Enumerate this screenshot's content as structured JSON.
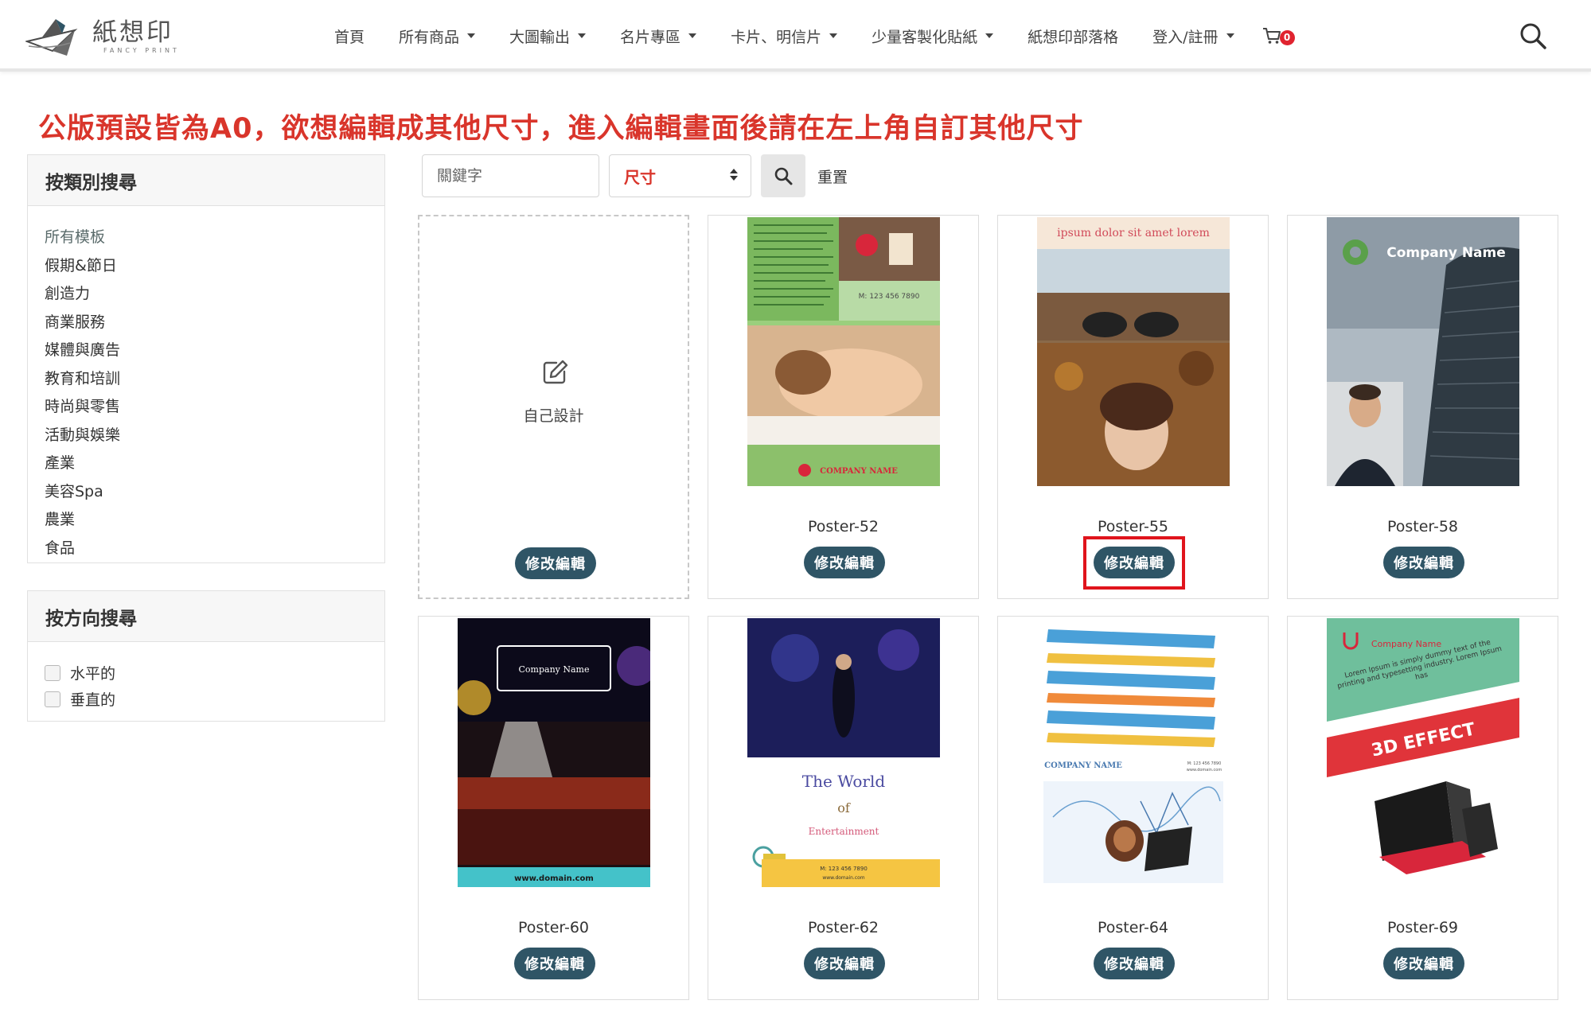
{
  "logo": {
    "cn": "紙想印",
    "en": "FANCY PRINT"
  },
  "nav": [
    {
      "label": "首頁",
      "dropdown": false
    },
    {
      "label": "所有商品",
      "dropdown": true
    },
    {
      "label": "大圖輸出",
      "dropdown": true
    },
    {
      "label": "名片專區",
      "dropdown": true
    },
    {
      "label": "卡片、明信片",
      "dropdown": true
    },
    {
      "label": "少量客製化貼紙",
      "dropdown": true
    },
    {
      "label": "紙想印部落格",
      "dropdown": false
    },
    {
      "label": "登入/註冊",
      "dropdown": true
    }
  ],
  "cart": {
    "count": "0"
  },
  "notice": "公版預設皆為A0，欲想編輯成其他尺寸，進入編輯畫面後請在左上角自訂其他尺寸",
  "category_panel": {
    "title": "按類別搜尋",
    "items": [
      "所有模板",
      "假期&節日",
      "創造力",
      "商業服務",
      "媒體與廣告",
      "教育和培訓",
      "時尚與零售",
      "活動與娛樂",
      "產業",
      "美容Spa",
      "農業",
      "食品"
    ]
  },
  "orientation_panel": {
    "title": "按方向搜尋",
    "options": [
      "水平的",
      "垂直的"
    ]
  },
  "filter": {
    "keyword_placeholder": "關鍵字",
    "size_label": "尺寸",
    "reset_label": "重置"
  },
  "design_card": {
    "label": "自己設計",
    "button": "修改編輯"
  },
  "templates": [
    {
      "name": "Poster-52",
      "button": "修改編輯"
    },
    {
      "name": "Poster-55",
      "button": "修改編輯"
    },
    {
      "name": "Poster-58",
      "button": "修改編輯"
    },
    {
      "name": "Poster-60",
      "button": "修改編輯"
    },
    {
      "name": "Poster-62",
      "button": "修改編輯"
    },
    {
      "name": "Poster-64",
      "button": "修改編輯"
    },
    {
      "name": "Poster-69",
      "button": "修改編輯"
    }
  ],
  "thumb_text": {
    "p52_phone": "M: 123 456 7890",
    "p52_company": "COMPANY NAME",
    "p55_title": "ipsum dolor sit amet lorem",
    "p58_company": "Company Name",
    "p60_company": "Company Name",
    "p60_url": "www.domain.com",
    "p62_line1": "The World",
    "p62_line2": "of",
    "p62_line3": "Entertainment",
    "p62_phone": "M: 123 456 7890",
    "p62_web": "www.domain.com",
    "p64_company": "COMPANY NAME",
    "p64_phone": "M: 123 456 7890",
    "p64_web": "www.domain.com",
    "p69_company": "Company Name",
    "p69_body": "Lorem Ipsum is simply dummy text of the printing and typesetting industry. Lorem Ipsum has",
    "p69_effect": "3D EFFECT"
  },
  "colors": {
    "accent_red": "#d9352b",
    "button": "#2f5566",
    "badge": "#e0232f",
    "highlight": "#e0141c"
  }
}
